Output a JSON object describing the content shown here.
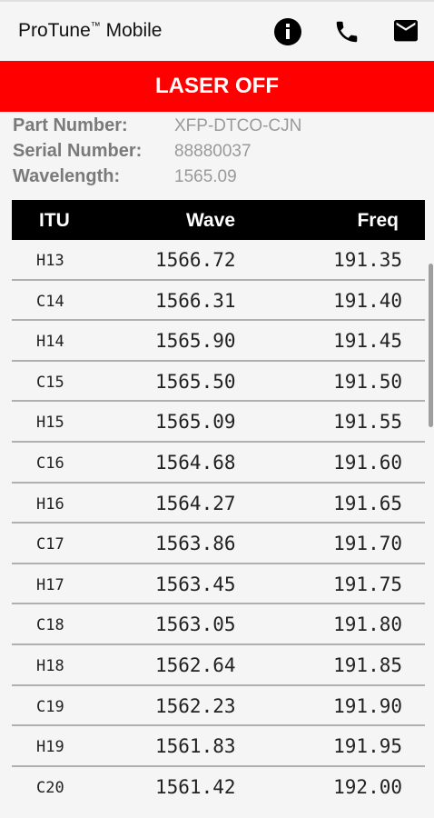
{
  "app": {
    "title": "ProTune",
    "trademark": "™",
    "title_suffix": " Mobile"
  },
  "icons": {
    "info": "info-circle-icon",
    "phone": "phone-icon",
    "mail": "mail-icon"
  },
  "banner": {
    "text": "LASER OFF",
    "color": "#ff0000"
  },
  "device": {
    "part_label": "Part Number:",
    "part_value": "XFP-DTCO-CJN",
    "serial_label": "Serial Number:",
    "serial_value": "88880037",
    "wavelength_label": "Wavelength:",
    "wavelength_value": "1565.09"
  },
  "table": {
    "headers": [
      "ITU",
      "Wave",
      "Freq"
    ],
    "rows": [
      [
        "H13",
        "1566.72",
        "191.35"
      ],
      [
        "C14",
        "1566.31",
        "191.40"
      ],
      [
        "H14",
        "1565.90",
        "191.45"
      ],
      [
        "C15",
        "1565.50",
        "191.50"
      ],
      [
        "H15",
        "1565.09",
        "191.55"
      ],
      [
        "C16",
        "1564.68",
        "191.60"
      ],
      [
        "H16",
        "1564.27",
        "191.65"
      ],
      [
        "C17",
        "1563.86",
        "191.70"
      ],
      [
        "H17",
        "1563.45",
        "191.75"
      ],
      [
        "C18",
        "1563.05",
        "191.80"
      ],
      [
        "H18",
        "1562.64",
        "191.85"
      ],
      [
        "C19",
        "1562.23",
        "191.90"
      ],
      [
        "H19",
        "1561.83",
        "191.95"
      ],
      [
        "C20",
        "1561.42",
        "192.00"
      ]
    ]
  }
}
